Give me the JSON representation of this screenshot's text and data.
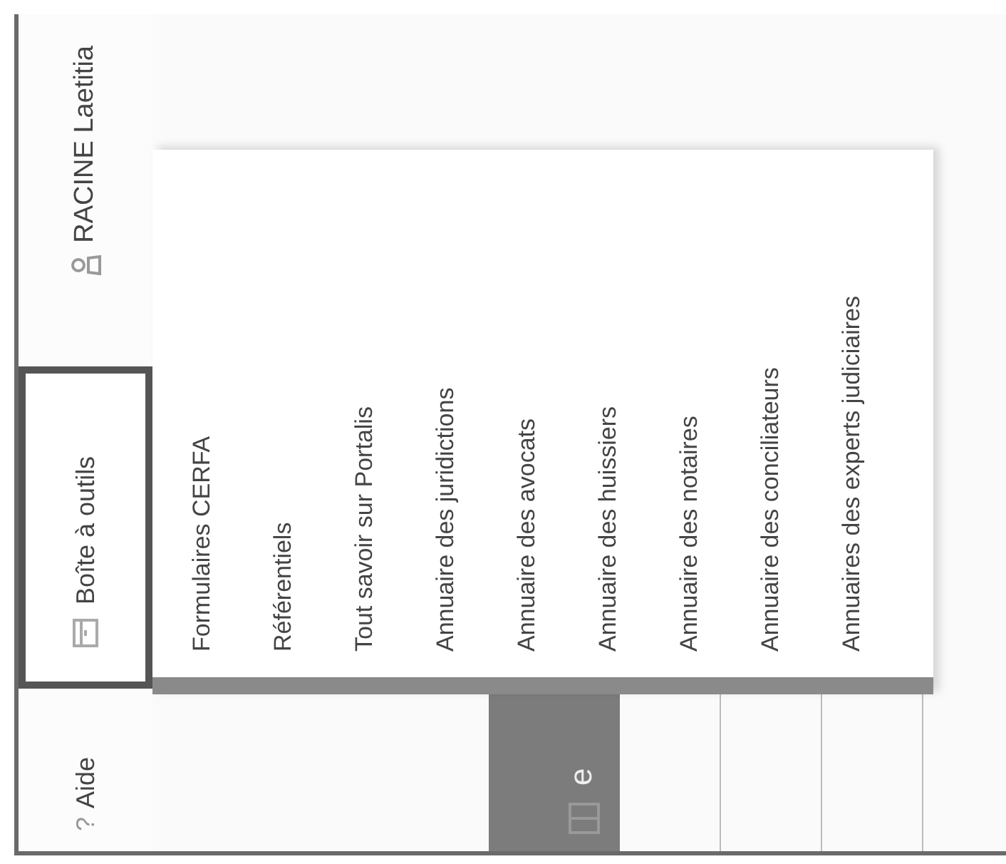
{
  "nav": {
    "help": {
      "icon": "?",
      "label": "Aide"
    },
    "tabs": [
      {
        "label": "Boîte à outils",
        "selected": true
      }
    ],
    "user": "RACINE Laetitia"
  },
  "menu": {
    "items": [
      "Formulaires CERFA",
      "Référentiels",
      "Tout savoir sur Portalis",
      "Annuaire des juridictions",
      "Annuaire des avocats",
      "Annuaire des huissiers",
      "Annuaire des notaires",
      "Annuaire des conciliateurs",
      "Annuaires des experts judiciaires"
    ]
  },
  "side_button": {
    "label": "e"
  }
}
